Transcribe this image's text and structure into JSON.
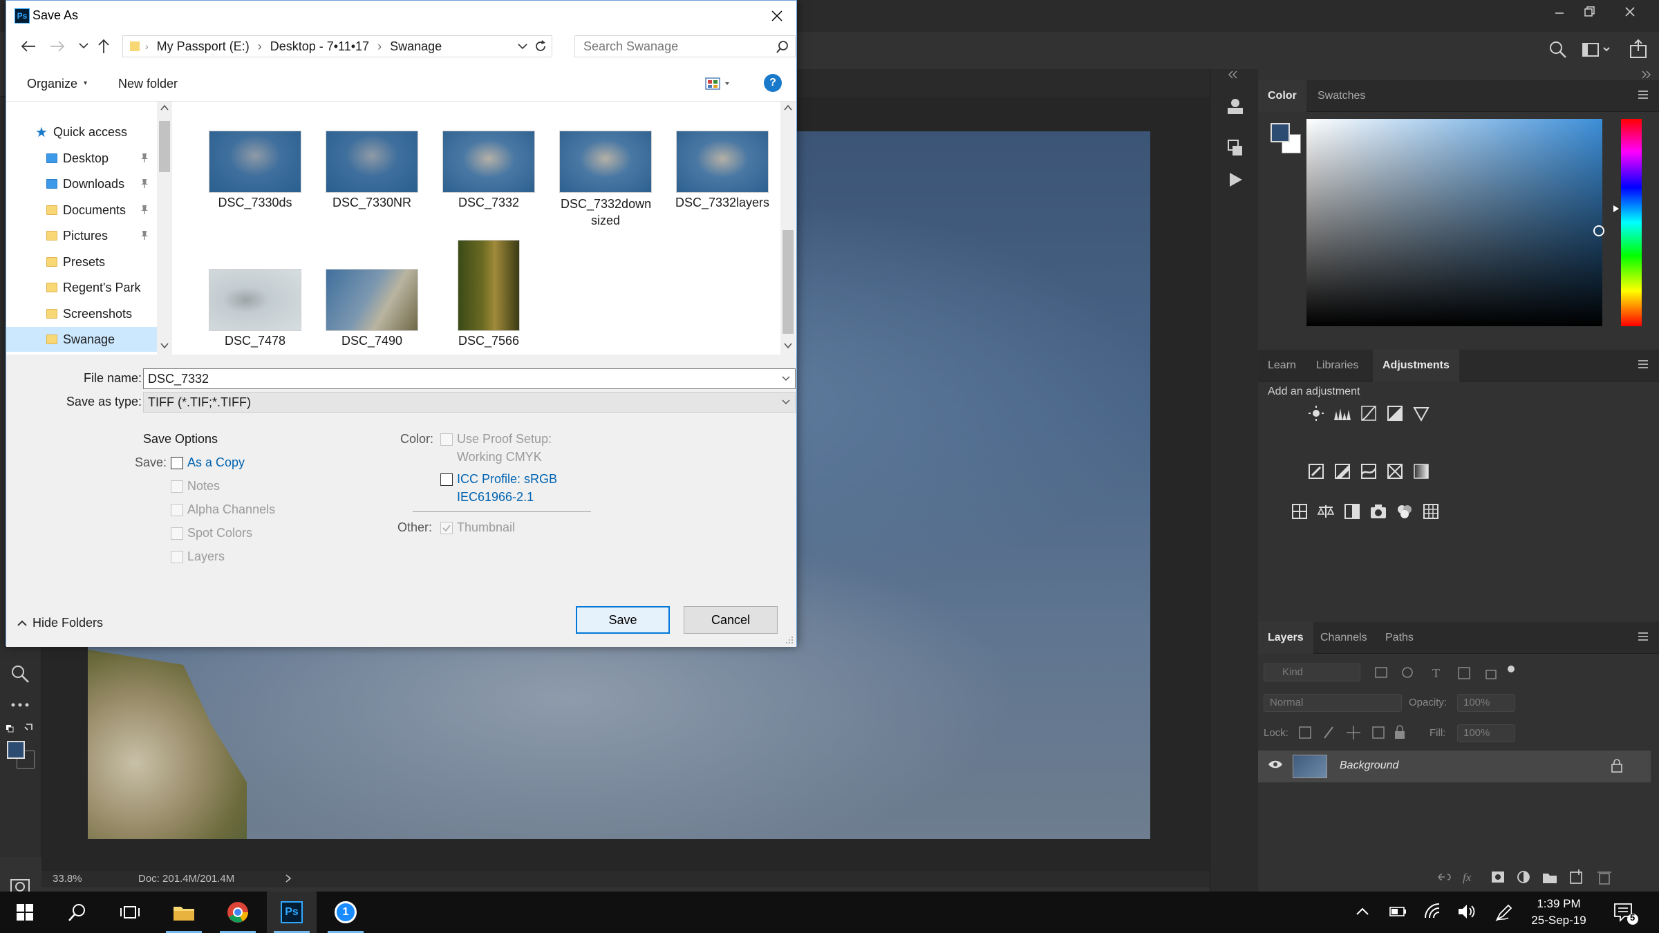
{
  "dialog": {
    "title": "Save As",
    "address": [
      "My Passport (E:)",
      "Desktop - 7•11•17",
      "Swanage"
    ],
    "search_placeholder": "Search Swanage",
    "organize_label": "Organize",
    "new_folder_label": "New folder",
    "help_label": "?",
    "nav_items": [
      {
        "label": "Quick access",
        "pinned": false
      },
      {
        "label": "Desktop",
        "pinned": true
      },
      {
        "label": "Downloads",
        "pinned": true
      },
      {
        "label": "Documents",
        "pinned": true
      },
      {
        "label": "Pictures",
        "pinned": true
      },
      {
        "label": "Presets",
        "pinned": false
      },
      {
        "label": "Regent's Park",
        "pinned": false
      },
      {
        "label": "Screenshots",
        "pinned": false
      },
      {
        "label": "Swanage",
        "pinned": false
      }
    ],
    "files": [
      {
        "name": "DSC_7330ds"
      },
      {
        "name": "DSC_7330NR"
      },
      {
        "name": "DSC_7332"
      },
      {
        "name": "DSC_7332down sized"
      },
      {
        "name": "DSC_7332layers"
      },
      {
        "name": "DSC_7478"
      },
      {
        "name": "DSC_7490"
      },
      {
        "name": "DSC_7566"
      }
    ],
    "file_name_label": "File name:",
    "file_name_value": "DSC_7332",
    "save_type_label": "Save as type:",
    "save_type_value": "TIFF (*.TIF;*.TIFF)",
    "save_options_heading": "Save Options",
    "save_label": "Save:",
    "options": {
      "as_copy": "As a Copy",
      "notes": "Notes",
      "alpha": "Alpha Channels",
      "spot": "Spot Colors",
      "layers": "Layers"
    },
    "color_label": "Color:",
    "use_proof": "Use Proof Setup:",
    "working_cmyk": "Working CMYK",
    "icc_profile": "ICC Profile:  sRGB",
    "icc_profile_2": "IEC61966-2.1",
    "other_label": "Other:",
    "thumbnail": "Thumbnail",
    "hide_folders": "Hide Folders",
    "save_button": "Save",
    "cancel_button": "Cancel"
  },
  "photoshop": {
    "zoom": "33.8%",
    "doc_info": "Doc: 201.4M/201.4M",
    "color_tabs": [
      "Color",
      "Swatches"
    ],
    "adjust_tabs": [
      "Learn",
      "Libraries",
      "Adjustments"
    ],
    "add_adjustment": "Add an adjustment",
    "layers_tabs": [
      "Layers",
      "Channels",
      "Paths"
    ],
    "kind_label": "Kind",
    "blend_mode": "Normal",
    "opacity_label": "Opacity:",
    "opacity_value": "100%",
    "lock_label": "Lock:",
    "fill_label": "Fill:",
    "fill_value": "100%",
    "layer_name": "Background",
    "fg_color": "#2c4c72",
    "bg_color": "#ffffff"
  },
  "taskbar": {
    "time": "1:39 PM",
    "date": "25-Sep-19",
    "notification_count": "5",
    "onepassword": "1",
    "ps_label": "Ps"
  }
}
